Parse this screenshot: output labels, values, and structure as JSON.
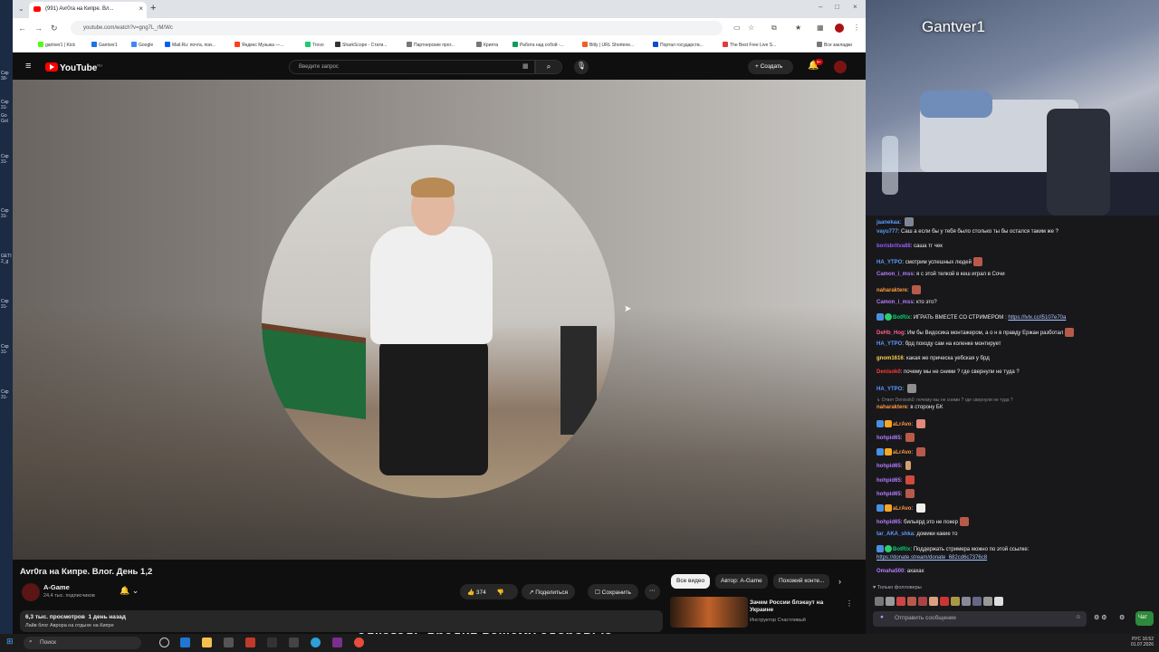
{
  "desktop": {
    "labels": [
      "Скр 30-",
      "Скр 31-",
      "Go Gol",
      "Скр 31-",
      "Скр 31-",
      "GETI 2_g",
      "Скр 31-",
      "Скр 31-",
      "Скр 31-"
    ]
  },
  "browser": {
    "tab_title": "(991) Avr0ra на Кипре. Вл...",
    "url": "youtube.com/watch?v=gng7L_rM/Wc",
    "bookmarks": [
      "gantver1 | Kick",
      "Gantver1",
      "Google",
      "Mail.Ru: почта, пои...",
      "Яндекс Музыка —...",
      "Trovo",
      "SharkScope - Стати...",
      "Партнерские прог...",
      "Крипта",
      "Работа над собой -...",
      "Bitly | URL Shortene...",
      "Портал государств...",
      "The Best Free Live S...",
      "Все закладки"
    ],
    "bookmark_colors": [
      "#53fc18",
      "#1a73e8",
      "#4285f4",
      "#005ff9",
      "#fc3f1d",
      "#1ecb6f",
      "#333333",
      "#666666",
      "#666666",
      "#0f9d58",
      "#ee6123",
      "#0d4cd3",
      "#e23b3b",
      "#666666"
    ]
  },
  "youtube": {
    "logo": "YouTube",
    "region": "RU",
    "search_placeholder": "Введите запрос",
    "create_label": "Создать",
    "notif_count": "9+",
    "video_title": "Avr0ra на Кипре. Влог. День 1,2",
    "channel": "A-Game",
    "subscribers": "24,4 тыс. подписчиков",
    "likes": "374",
    "share_label": "Поделиться",
    "save_label": "Сохранить",
    "views": "6,3 тыс. просмотров",
    "ago": "1 день назад",
    "desc_line": "Лайв блог Аврора на отдыхе на Кипре",
    "chips": [
      "Все видео",
      "Автор: A-Game",
      "Похожий конте..."
    ],
    "rec_title": "Зачем России блэкаут на Украине",
    "rec_channel": "Инструктор Счастливый"
  },
  "overlay": {
    "text": "алкоголь вредит вашему здоровью"
  },
  "stream": {
    "streamer": "Gantver1"
  },
  "chat": {
    "messages": [
      {
        "user": "jaanekaa",
        "text": "",
        "color": "#5b9bff"
      },
      {
        "user": "vayu777",
        "text": "Саш а если бы у тебя было столько ты бы остался таким же ?",
        "color": "#5b9bff"
      },
      {
        "user": "borisbritva88",
        "text": "саша тг чек",
        "color": "#9b59ff"
      },
      {
        "user": "HA_YTPO",
        "text": "смотрим успешных людей",
        "color": "#5b9bff"
      },
      {
        "user": "Camon_i_mss",
        "text": "я с этой телкой в кеш играл в Сочи",
        "color": "#b57bff"
      },
      {
        "user": "naharaktere",
        "text": "",
        "color": "#ff9a3c"
      },
      {
        "user": "Camon_i_mss",
        "text": "кто это?",
        "color": "#b57bff"
      },
      {
        "user": "BotRix",
        "text": "ИГРАТЬ ВМЕСТЕ СО СТРИМЕРОМ : ",
        "link": "https://lvlx.cc/l5107e70a",
        "color": "#00d26a"
      },
      {
        "user": "DeHb_Hog",
        "text": "Им бы Видосика монтажером, а о н в правду Ержан разботал",
        "color": "#ff5c8a"
      },
      {
        "user": "HA_YTPO",
        "text": "брд походу сам на коленке монтирует",
        "color": "#5b9bff"
      },
      {
        "user": "gnom1616",
        "text": "какая же прическа уебская у брд",
        "color": "#ffd24a"
      },
      {
        "user": "Denisok0",
        "text": "почему мы не сними ? где свернули не туда ?",
        "color": "#ff3b3b"
      },
      {
        "user": "HA_YTPO",
        "text": "",
        "color": "#5b9bff"
      },
      {
        "user": "naharaktere",
        "text": "в сторону БК",
        "color": "#ff9a3c"
      },
      {
        "user": "aLrAvo",
        "text": "",
        "color": "#ff9a3c"
      },
      {
        "user": "hohpid65",
        "text": "",
        "color": "#b57bff"
      },
      {
        "user": "aLrAvo",
        "text": "",
        "color": "#ff9a3c"
      },
      {
        "user": "hohpid65",
        "text": "",
        "color": "#b57bff"
      },
      {
        "user": "hohpid65",
        "text": "",
        "color": "#b57bff"
      },
      {
        "user": "hohpid65",
        "text": "",
        "color": "#b57bff"
      },
      {
        "user": "aLrAvo",
        "text": "",
        "color": "#ff9a3c"
      },
      {
        "user": "hohpid65",
        "text": "бильярд это не покер",
        "color": "#b57bff"
      },
      {
        "user": "tar_AKA_shka",
        "text": "домики какие то",
        "color": "#5b9bff"
      },
      {
        "user": "BotRix",
        "text": "Поддержать стримера можно по этой ссылке:",
        "color": "#00d26a"
      },
      {
        "user": "",
        "text": "",
        "link": "https://donate.stream/donate_682cd6c7376c8",
        "color": "#a9c7ff"
      },
      {
        "user": "Omaha500",
        "text": "ахахах",
        "color": "#b57bff"
      }
    ],
    "reply_note": "Ответ Denisok0: почему мы не сними ? где свернули не туда ?",
    "followers_only": "Только фолловеры",
    "input_placeholder": "Отправить сообщение",
    "chat_button": "Чат"
  },
  "taskbar": {
    "search": "Поиск",
    "lang": "РУС",
    "time": "16:52",
    "date": "01.07.2026"
  }
}
